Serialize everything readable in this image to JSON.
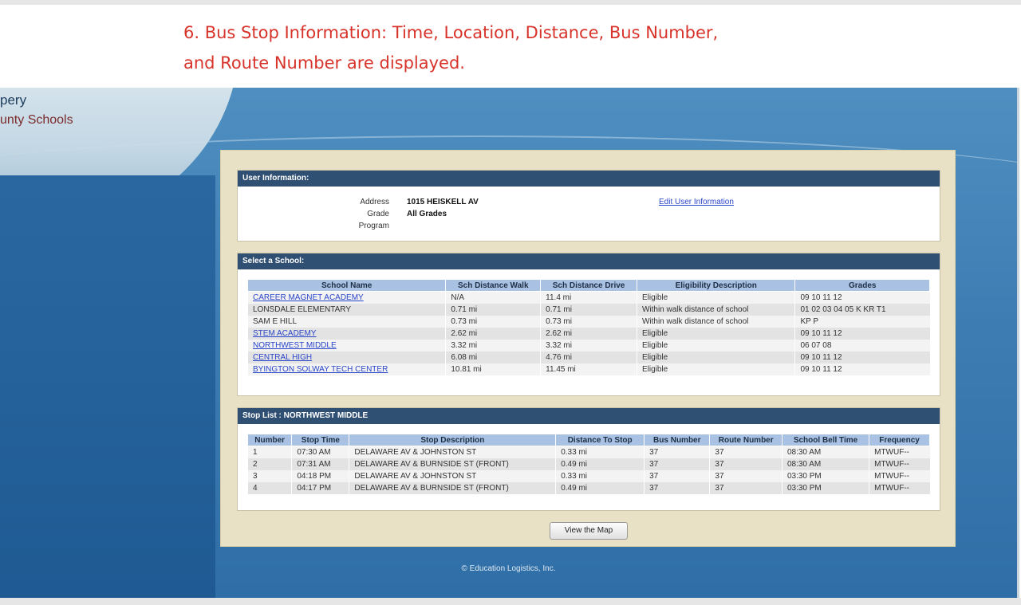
{
  "caption": {
    "line1": "6. Bus Stop Information: Time, Location, Distance, Bus Number,",
    "line2": "and Route Number are displayed."
  },
  "logo": {
    "line1": "pery",
    "line2": "unty Schools"
  },
  "user_info": {
    "header": "User Information:",
    "rows": [
      {
        "label": "Address",
        "value": "1015 HEISKELL AV"
      },
      {
        "label": "Grade",
        "value": "All Grades"
      },
      {
        "label": "Program",
        "value": ""
      }
    ],
    "edit_link": "Edit User Information"
  },
  "select_school": {
    "header": "Select a School:",
    "columns": [
      "School Name",
      "Sch Distance Walk",
      "Sch Distance Drive",
      "Eligibility Description",
      "Grades"
    ],
    "rows": [
      {
        "name": "CAREER MAGNET ACADEMY",
        "link": true,
        "walk": "N/A",
        "drive": "11.4 mi",
        "elig": "Eligible",
        "grades": "09 10 11 12"
      },
      {
        "name": "LONSDALE ELEMENTARY",
        "link": false,
        "walk": "0.71 mi",
        "drive": "0.71 mi",
        "elig": "Within walk distance of school",
        "grades": "01 02 03 04 05 K KR T1"
      },
      {
        "name": "SAM E HILL",
        "link": false,
        "walk": "0.73 mi",
        "drive": "0.73 mi",
        "elig": "Within walk distance of school",
        "grades": "KP P"
      },
      {
        "name": "STEM ACADEMY",
        "link": true,
        "walk": "2.62 mi",
        "drive": "2.62 mi",
        "elig": "Eligible",
        "grades": "09 10 11 12"
      },
      {
        "name": "NORTHWEST MIDDLE",
        "link": true,
        "walk": "3.32 mi",
        "drive": "3.32 mi",
        "elig": "Eligible",
        "grades": "06 07 08"
      },
      {
        "name": "CENTRAL HIGH",
        "link": true,
        "walk": "6.08 mi",
        "drive": "4.76 mi",
        "elig": "Eligible",
        "grades": "09 10 11 12"
      },
      {
        "name": "BYINGTON SOLWAY TECH CENTER",
        "link": true,
        "walk": "10.81 mi",
        "drive": "11.45 mi",
        "elig": "Eligible",
        "grades": "09 10 11 12"
      }
    ]
  },
  "stop_list": {
    "header": "Stop List : NORTHWEST MIDDLE",
    "columns": [
      "Number",
      "Stop Time",
      "Stop Description",
      "Distance To Stop",
      "Bus Number",
      "Route Number",
      "School Bell Time",
      "Frequency"
    ],
    "rows": [
      [
        "1",
        "07:30 AM",
        "DELAWARE AV & JOHNSTON ST",
        "0.33 mi",
        "37",
        "37",
        "08:30 AM",
        "MTWUF--"
      ],
      [
        "2",
        "07:31 AM",
        "DELAWARE AV & BURNSIDE ST (FRONT)",
        "0.49 mi",
        "37",
        "37",
        "08:30 AM",
        "MTWUF--"
      ],
      [
        "3",
        "04:18 PM",
        "DELAWARE AV & JOHNSTON ST",
        "0.33 mi",
        "37",
        "37",
        "03:30 PM",
        "MTWUF--"
      ],
      [
        "4",
        "04:17 PM",
        "DELAWARE AV & BURNSIDE ST (FRONT)",
        "0.49 mi",
        "37",
        "37",
        "03:30 PM",
        "MTWUF--"
      ]
    ]
  },
  "view_map_button": "View the Map",
  "footer": "© Education Logistics, Inc."
}
